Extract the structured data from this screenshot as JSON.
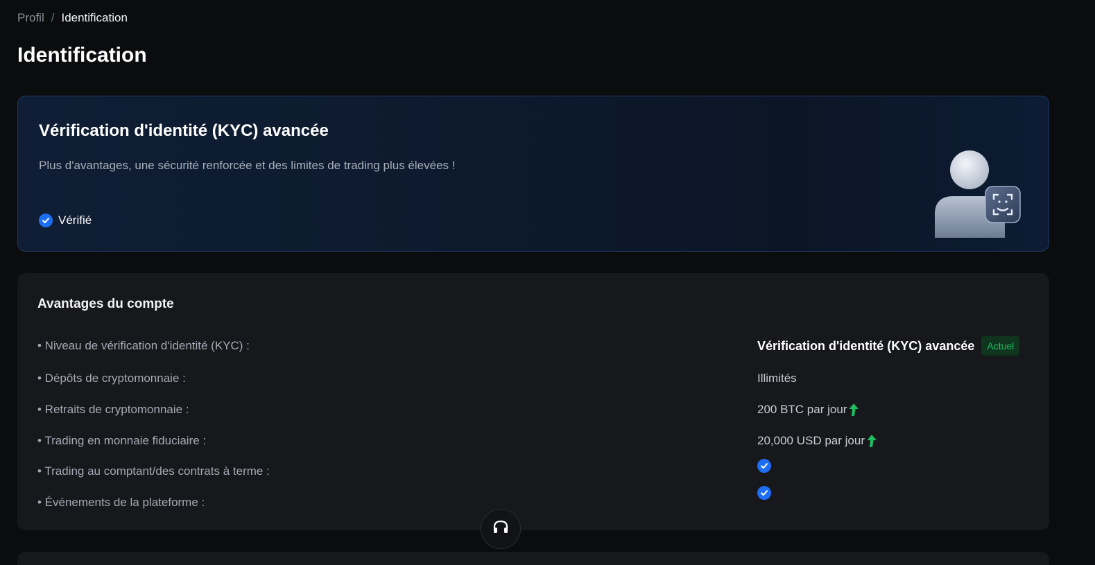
{
  "breadcrumb": {
    "parent": "Profil",
    "separator": "/",
    "current": "Identification"
  },
  "page_title": "Identification",
  "kyc_card": {
    "title": "Vérification d'identité (KYC) avancée",
    "description": "Plus d'avantages, une sécurité renforcée et des limites de trading plus élevées !",
    "status": "Vérifié",
    "status_icon": "check-circle-icon",
    "illustration": "user-face-id-icon"
  },
  "benefits": {
    "title": "Avantages du compte",
    "rows": [
      {
        "label": "• Niveau de vérification d'identité (KYC) :",
        "value": "Vérification d'identité (KYC) avancée",
        "badge": "Actuel"
      },
      {
        "label": "• Dépôts de cryptomonnaie :",
        "value": "Illimités"
      },
      {
        "label": "• Retraits de cryptomonnaie :",
        "value": "200 BTC par jour",
        "icon": "arrow-up-icon"
      },
      {
        "label": "• Trading en monnaie fiduciaire :",
        "value": "20,000 USD par jour",
        "icon": "arrow-up-icon"
      },
      {
        "label": "• Trading au comptant/des contrats à terme :",
        "icon": "check-circle-icon"
      },
      {
        "label": "• Événements de la plateforme :",
        "icon": "check-circle-icon"
      }
    ]
  },
  "support_button_icon": "headset-icon",
  "colors": {
    "background": "#0b0c0e",
    "card": "#17181c",
    "accent_blue": "#1e6ef5",
    "success_green": "#1fbd62"
  }
}
